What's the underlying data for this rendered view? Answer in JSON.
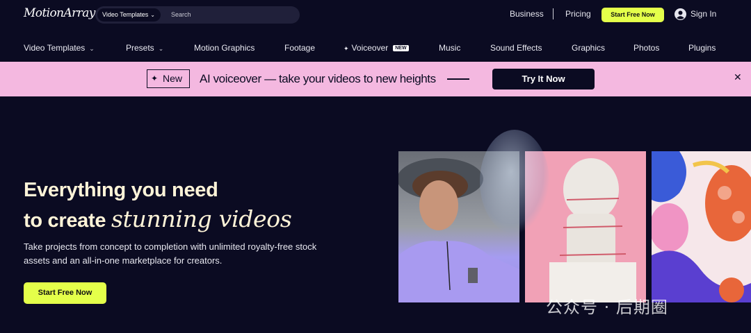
{
  "header": {
    "logo": "MotionArray",
    "search_category": "Video Templates",
    "search_placeholder": "Search",
    "business": "Business",
    "pricing": "Pricing",
    "start_free": "Start Free Now",
    "sign_in": "Sign In"
  },
  "nav": {
    "items": [
      "Video Templates",
      "Presets",
      "Motion Graphics",
      "Footage",
      "Voiceover",
      "Music",
      "Sound Effects",
      "Graphics",
      "Photos",
      "Plugins"
    ],
    "voiceover_badge": "NEW"
  },
  "banner": {
    "new_label": "New",
    "text": "AI voiceover — take your videos to new heights",
    "cta": "Try It Now"
  },
  "hero": {
    "title_line1": "Everything you need",
    "title_line2_prefix": "to create",
    "title_line2_italic": "stunning videos",
    "subtitle": "Take projects from concept to completion with unlimited royalty-free stock assets and an all-in-one marketplace for creators.",
    "cta": "Start Free Now"
  },
  "watermark": "公众号 · 后期圈",
  "colors": {
    "background": "#0b0b22",
    "accent_lime": "#e4ff4a",
    "banner_pink": "#f4b8e0",
    "hero_title": "#fff4d8"
  },
  "icons": {
    "search_chevron": "chevron-down-icon",
    "user": "user-circle-icon",
    "sparkle": "sparkle-icon",
    "close": "close-icon"
  }
}
